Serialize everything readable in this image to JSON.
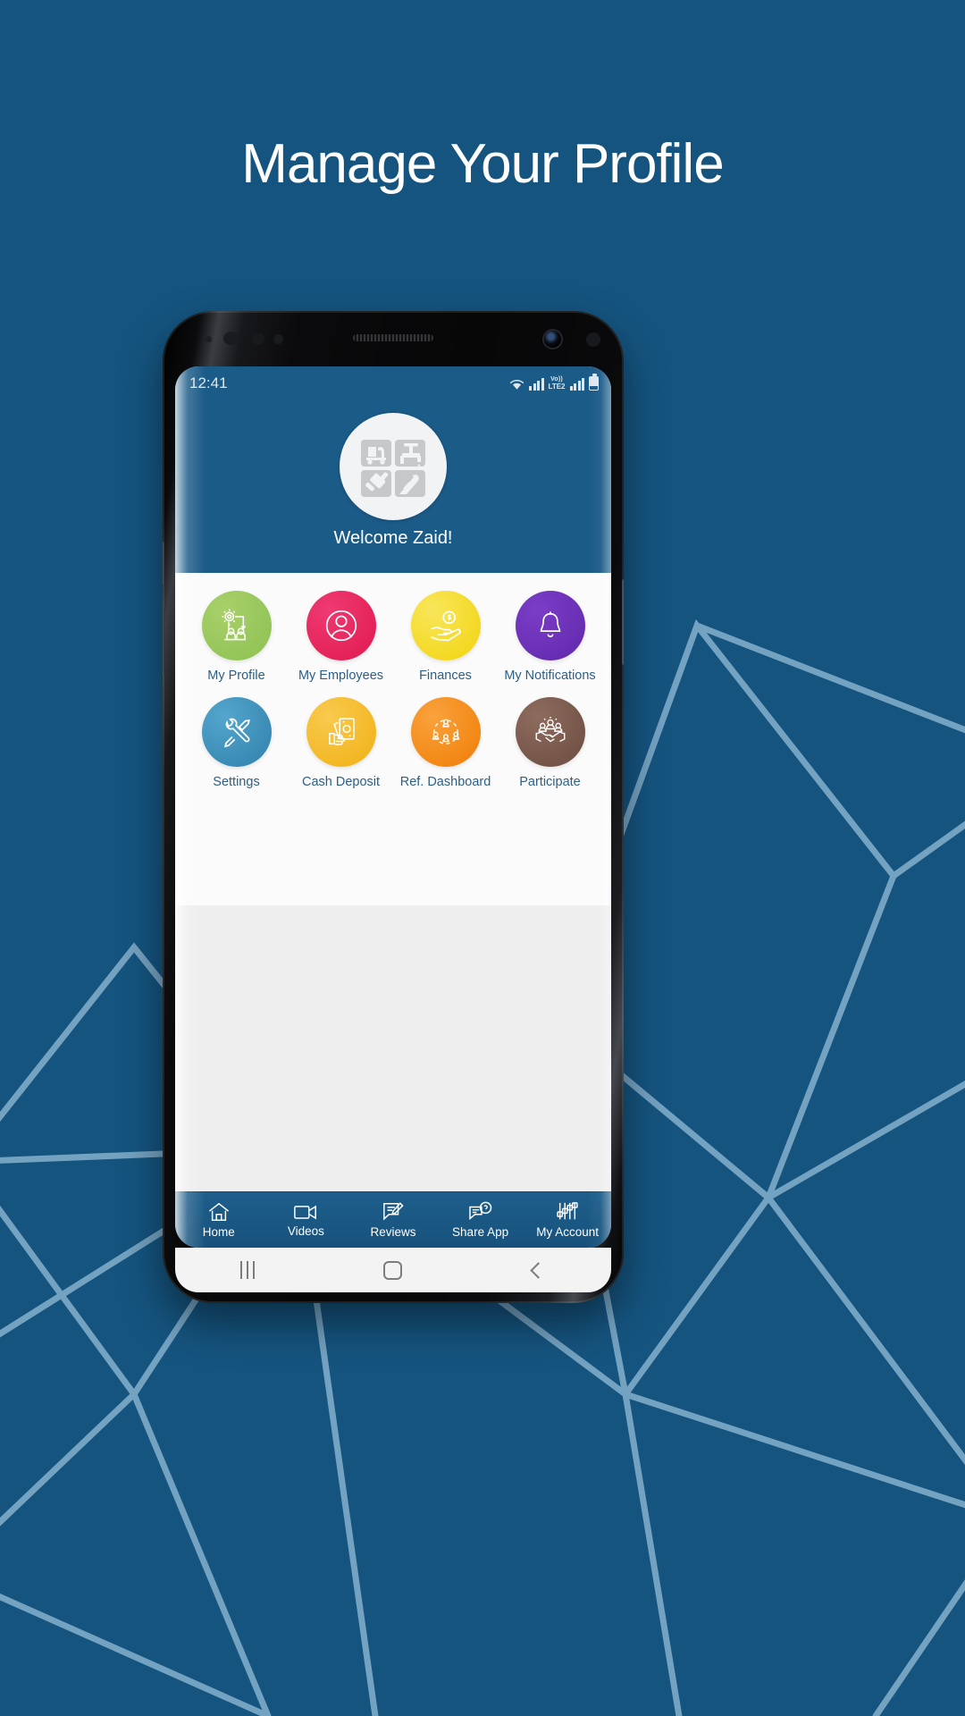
{
  "page": {
    "headline": "Manage Your Profile",
    "background_color": "#15547f",
    "polygon_line_color": "#8fb9d4"
  },
  "phone": {
    "status_bar": {
      "time": "12:41",
      "icons": [
        "wifi-icon",
        "signal-bars-icon",
        "volte-icon",
        "signal-bars-icon",
        "battery-icon"
      ],
      "volte_top": "Vo))",
      "volte_bottom": "LTE2",
      "background_color": "#1b5b88"
    },
    "app_header": {
      "logo_name": "app-logo",
      "welcome_text": "Welcome Zaid!",
      "background_color": "#1b5b88"
    },
    "features": {
      "rows": [
        [
          {
            "label": "My Profile",
            "icon": "profile-settings-icon",
            "color": "#8cc152",
            "color2": "#a8d06a"
          },
          {
            "label": "My Employees",
            "icon": "person-icon",
            "color": "#e8235e",
            "color2": "#ee3a72"
          },
          {
            "label": "Finances",
            "icon": "hand-money-icon",
            "color": "#f5d920",
            "color2": "#f7e243"
          },
          {
            "label": "My Notifications",
            "icon": "bell-icon",
            "color": "#6b2fb5",
            "color2": "#7b3ec7"
          }
        ],
        [
          {
            "label": "Settings",
            "icon": "tools-icon",
            "color": "#3d8fb9",
            "color2": "#4c9fc9"
          },
          {
            "label": "Cash Deposit",
            "icon": "cash-hand-icon",
            "color": "#f5bc28",
            "color2": "#f8c945"
          },
          {
            "label": "Ref. Dashboard",
            "icon": "network-icon",
            "color": "#f58a16",
            "color2": "#f89a2c"
          },
          {
            "label": "Participate",
            "icon": "handshake-icon",
            "color": "#76564a",
            "color2": "#876558"
          }
        ]
      ],
      "label_color": "#2c5f85",
      "background_color": "#fbfbfb"
    },
    "bottom_nav": {
      "items": [
        {
          "label": "Home",
          "icon": "home-icon"
        },
        {
          "label": "Videos",
          "icon": "video-camera-icon"
        },
        {
          "label": "Reviews",
          "icon": "review-edit-icon"
        },
        {
          "label": "Share App",
          "icon": "chat-question-icon"
        },
        {
          "label": "My Account",
          "icon": "sliders-icon"
        }
      ],
      "background_color": "#1b5b88"
    },
    "android_nav": {
      "items": [
        {
          "name": "recent-apps-button",
          "glyph": "|||"
        },
        {
          "name": "home-button",
          "glyph": "O"
        },
        {
          "name": "back-button",
          "glyph": "<"
        }
      ]
    }
  }
}
